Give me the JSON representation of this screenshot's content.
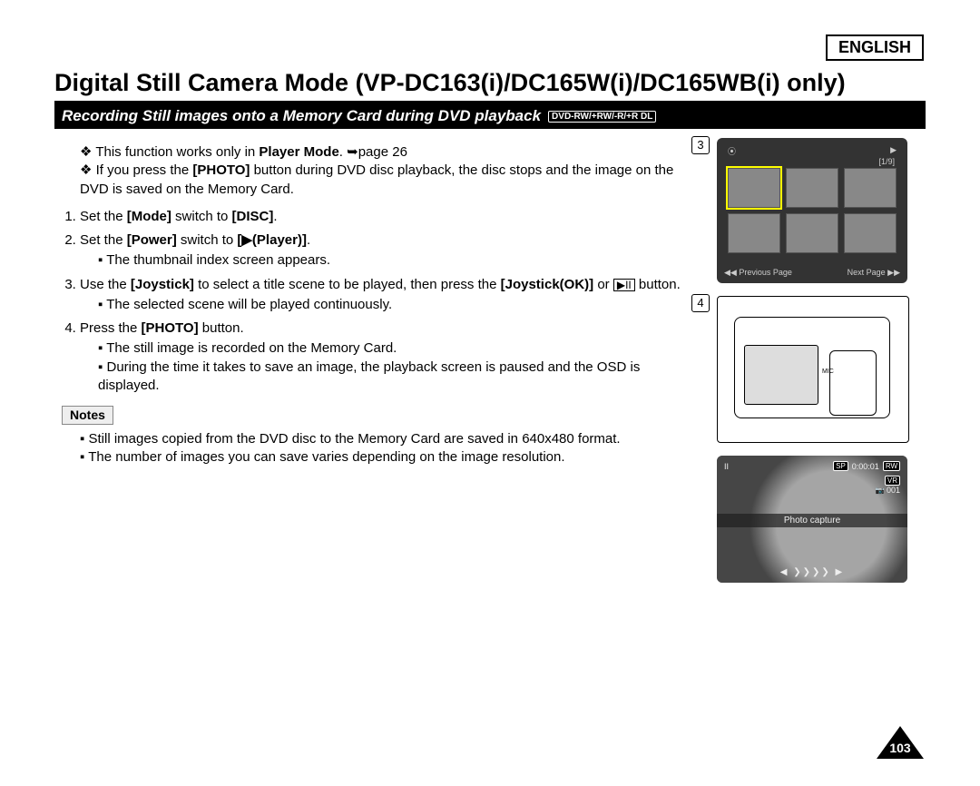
{
  "language_label": "ENGLISH",
  "main_title": "Digital Still Camera Mode (VP-DC163(i)/DC165W(i)/DC165WB(i) only)",
  "subtitle": "Recording Still images onto a Memory Card during DVD playback",
  "disc_types": "DVD-RW/+RW/-R/+R DL",
  "intro": {
    "b1_pre": "This function works only in ",
    "b1_bold": "Player Mode",
    "b1_post": ". ➥page 26",
    "b2_pre": "If you press the ",
    "b2_bold": "[PHOTO]",
    "b2_post": " button during DVD disc playback, the disc stops and the image on the DVD is saved on the Memory Card."
  },
  "steps": {
    "s1_pre": "Set the ",
    "s1_b1": "[Mode]",
    "s1_mid": " switch to ",
    "s1_b2": "[DISC]",
    "s1_post": ".",
    "s2_pre": "Set the ",
    "s2_b1": "[Power]",
    "s2_mid": " switch to ",
    "s2_b2": "[▶(Player)]",
    "s2_post": ".",
    "s2_sub1": "The thumbnail index screen appears.",
    "s3_pre": "Use the ",
    "s3_b1": "[Joystick]",
    "s3_mid": " to select a title scene to be played, then press the ",
    "s3_b2": "[Joystick(OK)]",
    "s3_post1": " or ",
    "s3_icon": "▶II",
    "s3_post2": " button.",
    "s3_sub1": "The selected scene will be played continuously.",
    "s4_pre": "Press the ",
    "s4_b1": "[PHOTO]",
    "s4_post": " button.",
    "s4_sub1": "The still image is recorded on the Memory Card.",
    "s4_sub2": "During the time it takes to save an image, the playback screen is paused and the OSD is displayed."
  },
  "notes_label": "Notes",
  "notes": {
    "n1": "Still images copied from the DVD disc to the Memory Card are saved in 640x480 format.",
    "n2": "The number of images you can save varies depending on the image resolution."
  },
  "fig3": {
    "num": "3",
    "counter": "[1/9]",
    "prev": "◀◀ Previous Page",
    "next": "Next Page ▶▶"
  },
  "fig4": {
    "num": "4",
    "mic": "MIC"
  },
  "fig5": {
    "pause": "II",
    "sp": "SP",
    "time": "0:00:01",
    "rw": "RW",
    "vr": "VR",
    "count": "001",
    "caption": "Photo capture",
    "nav": "◀  ❯❯❯❯  ▶"
  },
  "page_number": "103"
}
